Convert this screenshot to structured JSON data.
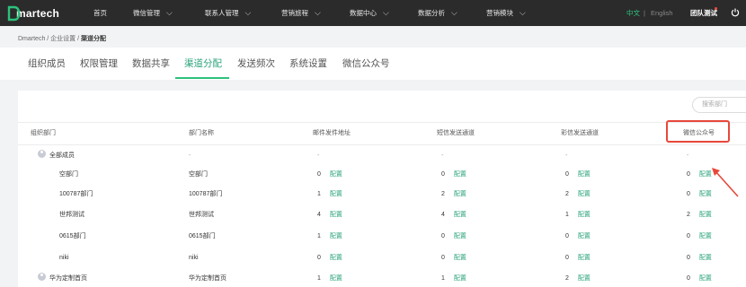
{
  "brand": {
    "name": "martech",
    "accent": "#2dc27d",
    "nav_bg": "#2b2b2b"
  },
  "nav": {
    "items": [
      {
        "label": "首页",
        "dropdown": false
      },
      {
        "label": "微信管理",
        "dropdown": true
      },
      {
        "label": "联系人管理",
        "dropdown": true
      },
      {
        "label": "营销旅程",
        "dropdown": true
      },
      {
        "label": "数据中心",
        "dropdown": true
      },
      {
        "label": "数据分析",
        "dropdown": true
      },
      {
        "label": "营销模块",
        "dropdown": true
      }
    ],
    "lang_zh": "中文",
    "lang_sep": "|",
    "lang_en": "English",
    "team": "团队测试",
    "power_icon": "power-icon"
  },
  "breadcrumb": {
    "path": "Dmartech / 企业设置 / ",
    "current": "渠道分配"
  },
  "tabs": [
    "组织成员",
    "权限管理",
    "数据共享",
    "渠道分配",
    "发送频次",
    "系统设置",
    "微信公众号"
  ],
  "active_tab": 3,
  "search": {
    "placeholder": "搜索部门"
  },
  "table": {
    "headers": [
      "组织部门",
      "部门名称",
      "邮件发件地址",
      "短信发送通道",
      "彩信发送通道",
      "微信公众号"
    ],
    "config_label": "配置",
    "rows": [
      {
        "org": "全部成员",
        "name": "-",
        "email": "-",
        "sms": "-",
        "mms": "-",
        "wechat": "-",
        "top": true
      },
      {
        "org": "空部门",
        "name": "空部门",
        "email": "0",
        "sms": "0",
        "mms": "0",
        "wechat": "0"
      },
      {
        "org": "100787部门",
        "name": "100787部门",
        "email": "1",
        "sms": "2",
        "mms": "2",
        "wechat": "0"
      },
      {
        "org": "世邦测试",
        "name": "世邦测试",
        "email": "4",
        "sms": "4",
        "mms": "1",
        "wechat": "2"
      },
      {
        "org": "0615部门",
        "name": "0615部门",
        "email": "1",
        "sms": "0",
        "mms": "0",
        "wechat": "0"
      },
      {
        "org": "niki",
        "name": "niki",
        "email": "0",
        "sms": "0",
        "mms": "0",
        "wechat": "0"
      },
      {
        "org": "华为定制首页",
        "name": "华为定制首页",
        "email": "1",
        "sms": "1",
        "mms": "2",
        "wechat": "0",
        "top": true
      }
    ]
  },
  "annotation_color": "#e8483a"
}
